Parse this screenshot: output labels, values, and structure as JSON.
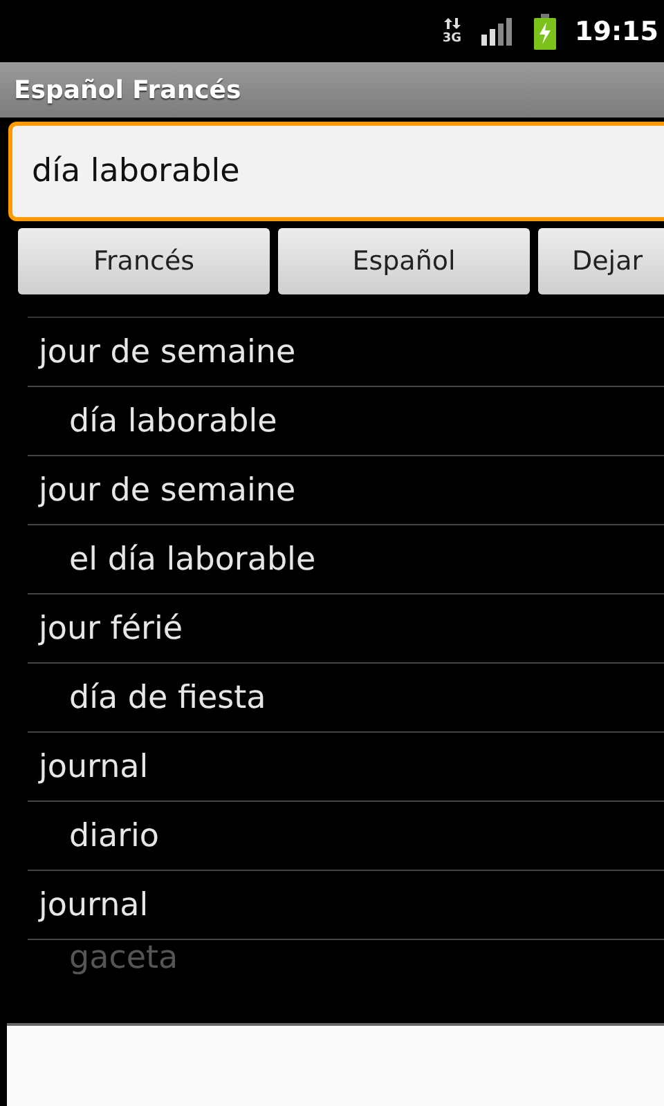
{
  "status_bar": {
    "time": "19:15",
    "network": "3G"
  },
  "window": {
    "title": "Español Francés"
  },
  "search": {
    "value": "día laborable"
  },
  "buttons": [
    "Francés",
    "Español",
    "Dejar"
  ],
  "results": [
    {
      "kind": "term",
      "text": "jour de semaine"
    },
    {
      "kind": "translation",
      "text": "día laborable"
    },
    {
      "kind": "term",
      "text": "jour de semaine"
    },
    {
      "kind": "translation",
      "text": "el día laborable"
    },
    {
      "kind": "term",
      "text": "jour férié"
    },
    {
      "kind": "translation",
      "text": "día de fiesta"
    },
    {
      "kind": "term",
      "text": "journal"
    },
    {
      "kind": "translation",
      "text": "diario"
    },
    {
      "kind": "term",
      "text": "journal"
    },
    {
      "kind": "translation",
      "text": "gaceta"
    }
  ]
}
